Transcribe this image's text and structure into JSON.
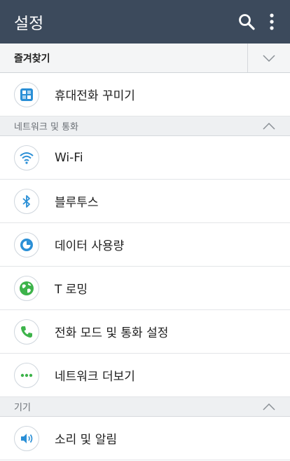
{
  "appbar": {
    "title": "설정"
  },
  "favorites": {
    "label": "즐겨찾기"
  },
  "favorites_items": [
    {
      "label": "휴대전화 꾸미기",
      "icon": "phone-customize-icon"
    }
  ],
  "network_section": {
    "label": "네트워크 및 통화",
    "items": [
      {
        "label": "Wi-Fi",
        "icon": "wifi-icon"
      },
      {
        "label": "블루투스",
        "icon": "bluetooth-icon"
      },
      {
        "label": "데이터 사용량",
        "icon": "data-usage-icon"
      },
      {
        "label": "T 로밍",
        "icon": "globe-icon"
      },
      {
        "label": "전화 모드 및 통화 설정",
        "icon": "phone-icon"
      },
      {
        "label": "네트워크 더보기",
        "icon": "more-icon"
      }
    ]
  },
  "device_section": {
    "label": "기기",
    "items": [
      {
        "label": "소리 및 알림",
        "icon": "speaker-icon"
      }
    ]
  },
  "colors": {
    "appbar": "#3c4a5c",
    "accent_blue": "#2a8fd6",
    "accent_green": "#3db34a"
  }
}
